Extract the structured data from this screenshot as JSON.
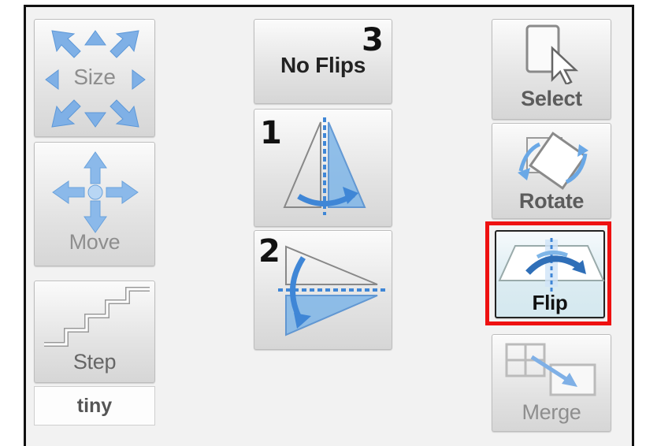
{
  "left_panel": {
    "size_label": "Size",
    "move_label": "Move",
    "step_label": "Step",
    "step_value": "tiny"
  },
  "center_panel": {
    "no_flips_label": "No Flips",
    "annotation_1": "1",
    "annotation_2": "2",
    "annotation_3": "3"
  },
  "right_panel": {
    "select_label": "Select",
    "rotate_label": "Rotate",
    "flip_label": "Flip",
    "merge_label": "Merge"
  },
  "colors": {
    "accent_blue": "#3f86d6",
    "highlight_red": "#ee1111",
    "selected_bg": "#dcecf2"
  },
  "icons": {
    "size": "resize-arrows-icon",
    "move": "move-arrows-icon",
    "step": "stairs-icon",
    "flip_vertical_axis": "flip-vertical-axis-icon",
    "flip_horizontal_axis": "flip-horizontal-axis-icon",
    "select": "cursor-select-icon",
    "rotate": "rotate-icon",
    "flip": "flip-icon",
    "merge": "merge-grid-icon"
  }
}
